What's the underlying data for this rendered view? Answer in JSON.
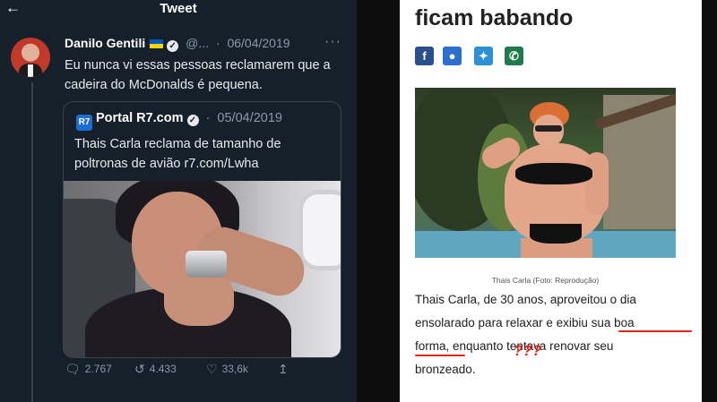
{
  "tweet": {
    "header_title": "Tweet",
    "author_name": "Danilo Gentili",
    "handle": "@...",
    "date": "06/04/2019",
    "more": "···",
    "text": "Eu nunca vi essas pessoas reclamarem que a cadeira do McDonalds é pequena.",
    "quoted": {
      "author_name": "Portal R7.com",
      "date": "05/04/2019",
      "text": "Thais Carla reclama de tamanho de poltronas de avião  r7.com/Lwha"
    },
    "actions": {
      "replies": "2.767",
      "retweets": "4.433",
      "likes": "33,6k"
    }
  },
  "article": {
    "title": "ficam babando",
    "share_icons": [
      "facebook-icon",
      "messenger-icon",
      "twitter-icon",
      "whatsapp-icon"
    ],
    "photo_caption": "Thais Carla (Foto: Reprodução)",
    "body": {
      "line1": "Thais Carla, de 30 anos, aproveitou o dia",
      "line2_a": "ensolarado para relaxar e exibiu ",
      "line2_b": "sua boa",
      "line3_a": "forma",
      "line3_b": ", enquanto tentava renovar seu",
      "line4": "bronzeado."
    },
    "annotation": "???",
    "annotation_color": "#e0261b"
  }
}
